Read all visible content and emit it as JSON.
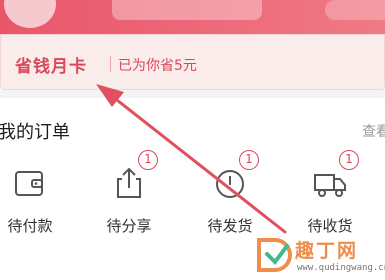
{
  "savings_card": {
    "title": "省钱月卡",
    "subtitle": "已为你省5元"
  },
  "orders": {
    "title": "我的订单",
    "more_label": "查看",
    "items": [
      {
        "label": "待付款",
        "icon": "wallet-icon",
        "badge": ""
      },
      {
        "label": "待分享",
        "icon": "share-icon",
        "badge": "1"
      },
      {
        "label": "待发货",
        "icon": "clock-icon",
        "badge": "1"
      },
      {
        "label": "待收货",
        "icon": "truck-icon",
        "badge": "1"
      }
    ]
  },
  "annotation": {
    "arrow_color": "#e0505e"
  },
  "watermark": {
    "text": "趣丁网",
    "url": "www.qudingwang.cn"
  },
  "colors": {
    "accent": "#d9495b",
    "header": "#e9566a",
    "card_bg": "#fbecec",
    "watermark": "#ef8d4d"
  }
}
